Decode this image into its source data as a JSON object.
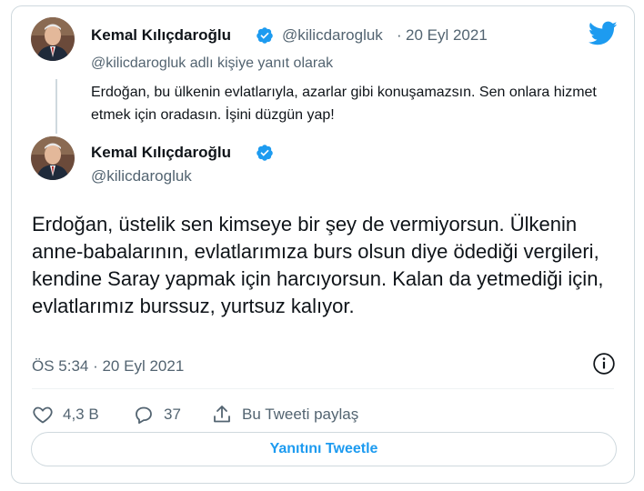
{
  "colors": {
    "accent": "#1d9bf0",
    "muted": "#536471",
    "text": "#0f1419",
    "border": "#cfd9de"
  },
  "quoted_tweet": {
    "author_name": "Kemal Kılıçdaroğlu",
    "handle": "@kilicdarogluk",
    "separator": "·",
    "date": "20 Eyl 2021",
    "reply_to": "@kilicdarogluk adlı kişiye yanıt olarak",
    "text": "Erdoğan, bu ülkenin evlatlarıyla, azarlar gibi konuşamazsın. Sen onlara hizmet etmek için oradasın. İşini düzgün yap!"
  },
  "main_tweet": {
    "author_name": "Kemal Kılıçdaroğlu",
    "handle": "@kilicdarogluk",
    "text": "Erdoğan, üstelik sen kimseye bir şey de vermiyorsun. Ülkenin anne-babalarının, evlatlarımıza burs olsun diye ödediği vergileri, kendine Saray yapmak için harcıyorsun. Kalan da yetmediği için, evlatlarımız burssuz, yurtsuz kalıyor.",
    "timestamp": "ÖS 5:34 · 20 Eyl 2021"
  },
  "actions": {
    "like_count": "4,3 B",
    "reply_count": "37",
    "share_label": "Bu Tweeti paylaş"
  },
  "reply_button_label": "Yanıtını Tweetle",
  "icons": [
    "twitter-logo-icon",
    "verified-badge-icon",
    "info-icon",
    "heart-icon",
    "reply-icon",
    "share-icon"
  ]
}
